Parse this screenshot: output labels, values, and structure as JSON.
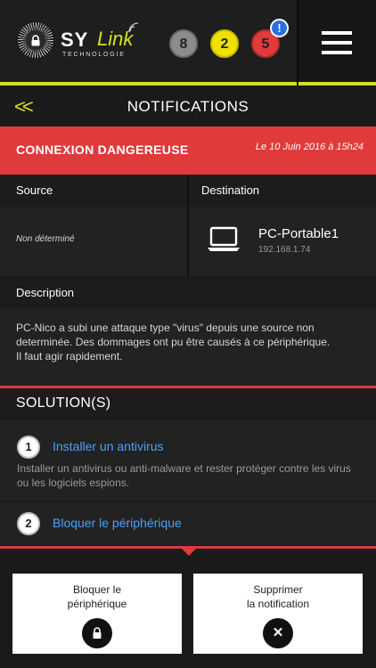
{
  "header": {
    "logo_primary": "SY",
    "logo_secondary": "Link",
    "logo_subtitle": "TECHNOLOGIE",
    "badges": [
      {
        "count": "8",
        "color": "#8c8c8c"
      },
      {
        "count": "2",
        "color": "#f0e000"
      },
      {
        "count": "5",
        "color": "#e13a3a"
      }
    ],
    "alert_indicator": "!",
    "menu_icon": "hamburger-icon"
  },
  "titlebar": {
    "back_icon": "double-chevron-left-icon",
    "back_label": "<<",
    "title": "NOTIFICATIONS"
  },
  "notification": {
    "type": "CONNEXION DANGEREUSE",
    "date": "Le 10 Juin 2016 à 15h24",
    "source_label": "Source",
    "destination_label": "Destination",
    "source_value": "Non déterminé",
    "destination": {
      "icon": "laptop-icon",
      "name": "PC-Portable1",
      "ip": "192.168.1.74"
    },
    "description_label": "Description",
    "description_lines": [
      "PC-Nico a subi une attaque type \"virus\" depuis une source non",
      "determinée. Des dommages ont pu être causés à ce périphérique.",
      "Il faut agir rapidement."
    ]
  },
  "solutions": {
    "heading": "SOLUTION(S)",
    "items": [
      {
        "number": "1",
        "title": "Installer un  antivirus",
        "description": "Installer un antivirus ou anti-malware et rester protéger contre les virus ou les logiciels espions."
      },
      {
        "number": "2",
        "title": "Bloquer le périphérique"
      }
    ]
  },
  "actions": {
    "block": {
      "line1": "Bloquer le",
      "line2": "périphérique",
      "icon": "lock-icon"
    },
    "delete": {
      "line1": "Supprimer",
      "line2": "la notification",
      "icon": "close-icon",
      "glyph": "✕"
    }
  },
  "colors": {
    "accent_yellow": "#d7e022",
    "alert_red": "#e13a3a",
    "link_blue": "#4aa0ff"
  }
}
